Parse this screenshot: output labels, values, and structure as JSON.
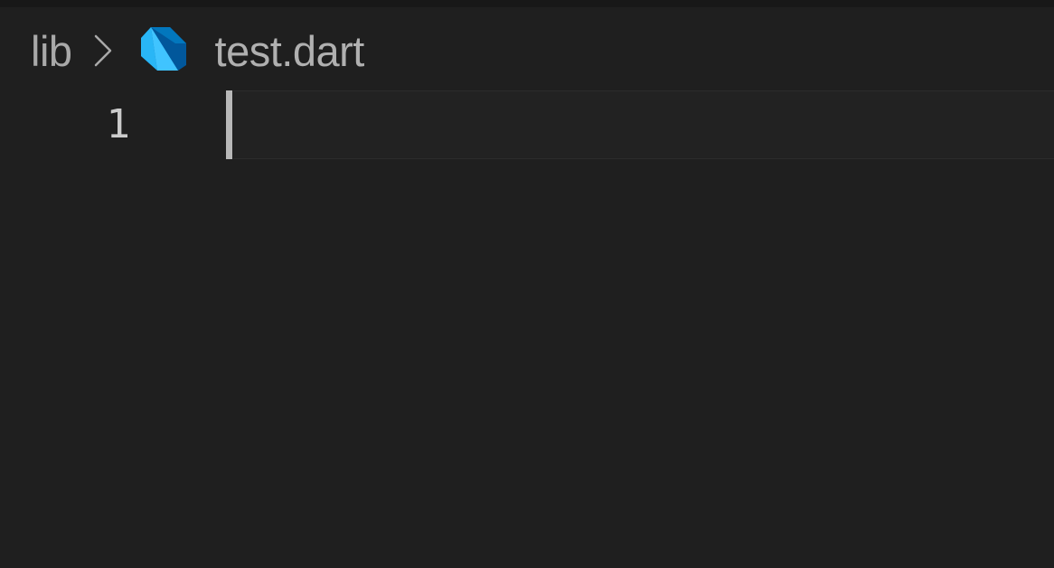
{
  "breadcrumb": {
    "folder": "lib",
    "file": "test.dart",
    "file_icon": "dart-icon",
    "separator_icon": "chevron-right-icon"
  },
  "editor": {
    "line_numbers": [
      "1"
    ],
    "current_line": 1
  },
  "colors": {
    "background": "#1f1f1f",
    "text": "#a9a9a9",
    "dart_light": "#40c4ff",
    "dart_dark": "#01579b"
  }
}
